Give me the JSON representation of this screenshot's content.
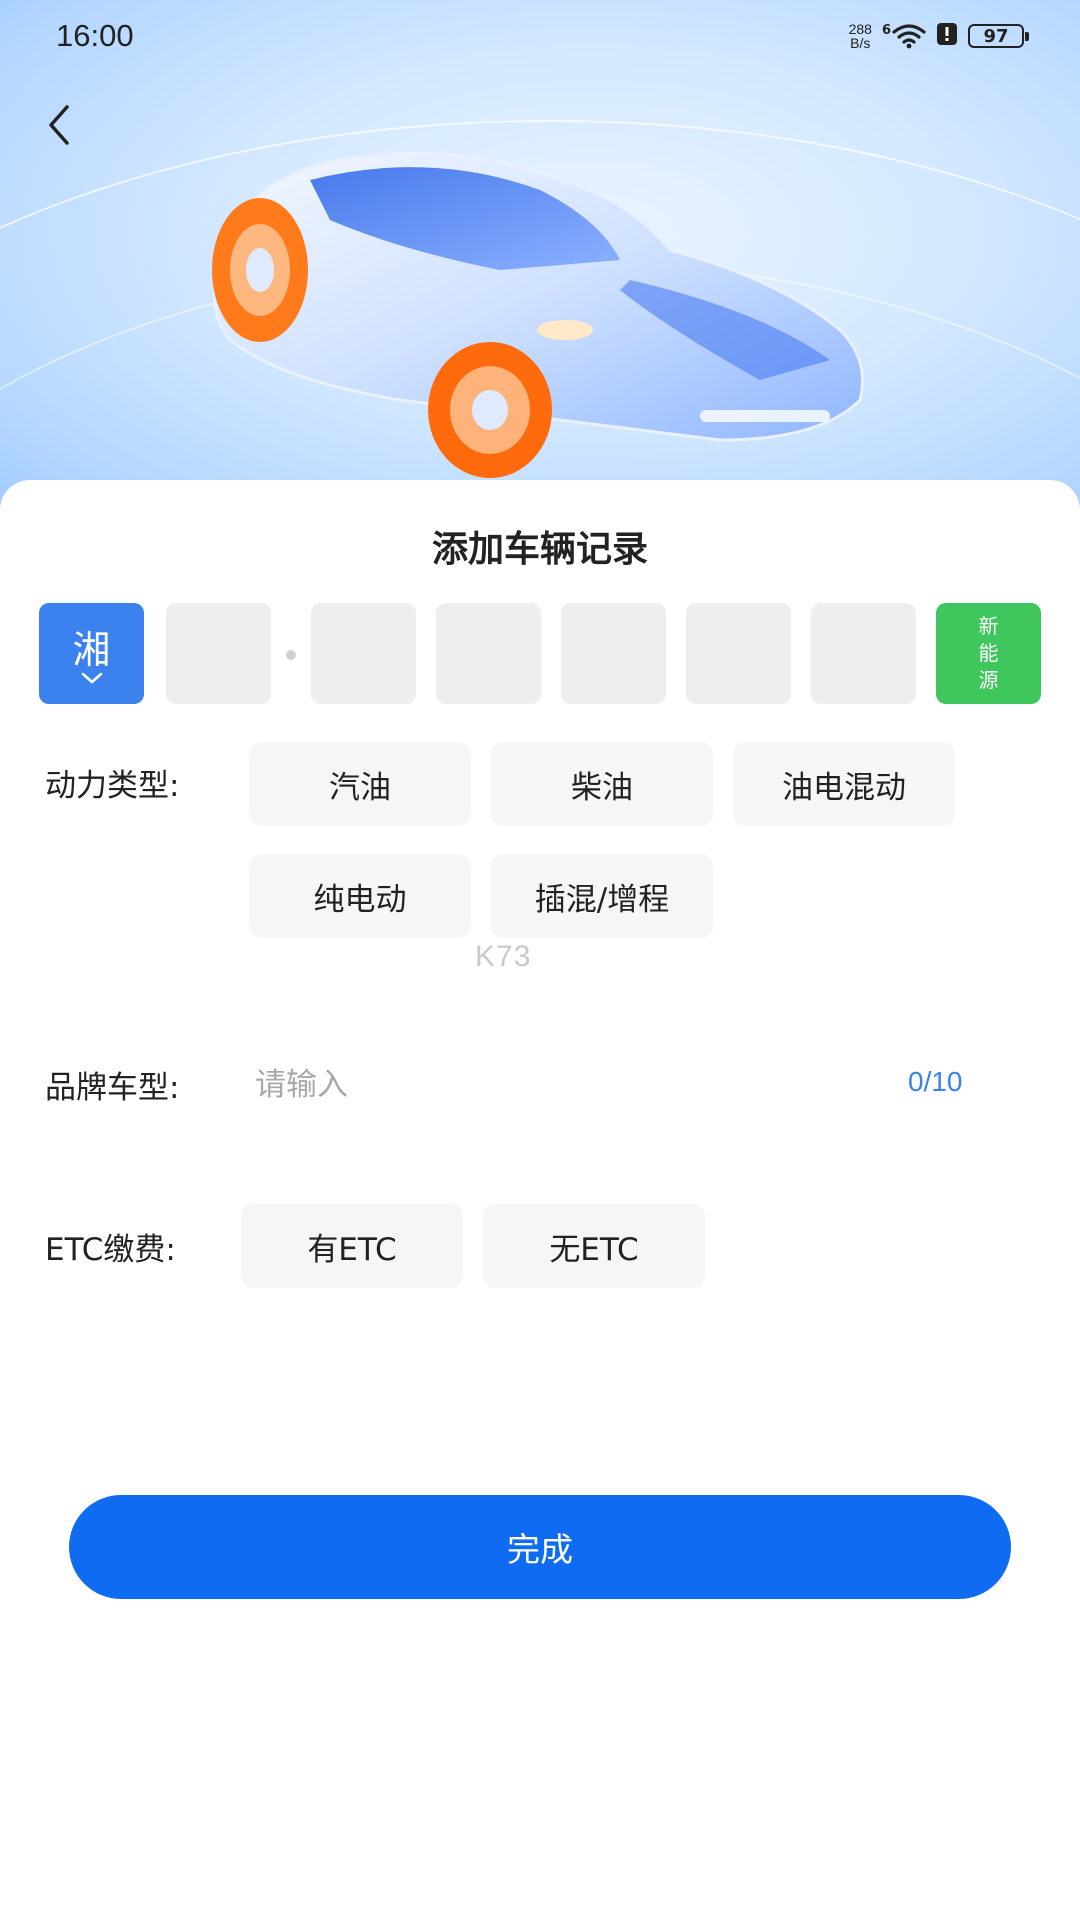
{
  "status_bar": {
    "time": "16:00",
    "net_speed_value": "288",
    "net_speed_unit": "B/s",
    "signal_label": "6",
    "battery": "97"
  },
  "header": {
    "title": "添加车辆记录"
  },
  "plate": {
    "province": "湘",
    "new_energy_label": "新能源"
  },
  "power_type": {
    "label": "动力类型:",
    "options": [
      "汽油",
      "柴油",
      "油电混动",
      "纯电动",
      "插混/增程"
    ]
  },
  "watermark": "K73",
  "brand": {
    "label": "品牌车型:",
    "placeholder": "请输入",
    "counter": "0/10"
  },
  "etc": {
    "label": "ETC缴费:",
    "options": [
      "有ETC",
      "无ETC"
    ]
  },
  "submit_label": "完成",
  "colors": {
    "primary": "#0f6cf2",
    "province_bg": "#3b82ef",
    "new_energy_bg": "#3fc75e",
    "option_bg": "#f6f6f6"
  }
}
